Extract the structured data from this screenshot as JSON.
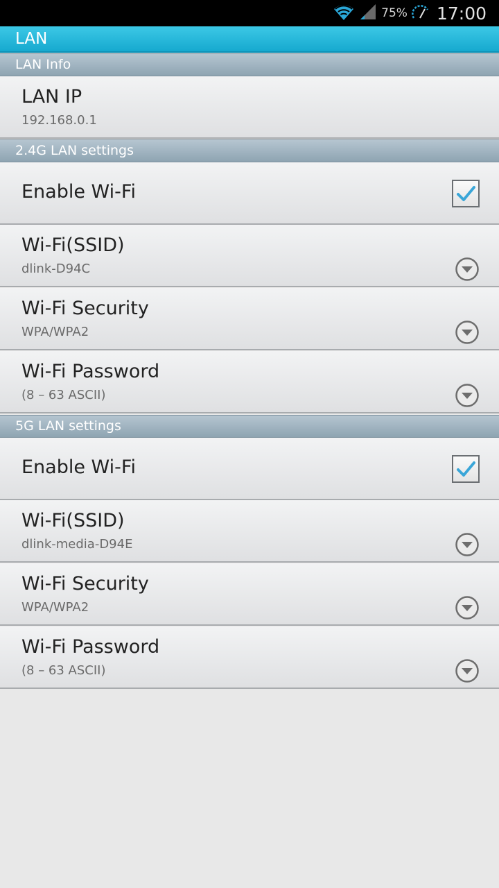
{
  "status_bar": {
    "battery": "75%",
    "time": "17:00",
    "icons": [
      "wifi-signal-icon",
      "cellular-signal-icon",
      "speed-meter-icon"
    ]
  },
  "title_bar": {
    "title": "LAN"
  },
  "sections": {
    "lan_info": {
      "header": "LAN Info",
      "items": [
        {
          "title": "LAN IP",
          "subtitle": "192.168.0.1"
        }
      ]
    },
    "lan_24g": {
      "header": "2.4G LAN settings",
      "enable_wifi": {
        "title": "Enable Wi-Fi",
        "checked": true
      },
      "items": [
        {
          "title": "Wi-Fi(SSID)",
          "subtitle": "dlink-D94C"
        },
        {
          "title": "Wi-Fi Security",
          "subtitle": "WPA/WPA2"
        },
        {
          "title": "Wi-Fi Password",
          "subtitle": "(8 – 63 ASCII)"
        }
      ]
    },
    "lan_5g": {
      "header": "5G LAN settings",
      "enable_wifi": {
        "title": "Enable Wi-Fi",
        "checked": true
      },
      "items": [
        {
          "title": "Wi-Fi(SSID)",
          "subtitle": "dlink-media-D94E"
        },
        {
          "title": "Wi-Fi Security",
          "subtitle": "WPA/WPA2"
        },
        {
          "title": "Wi-Fi Password",
          "subtitle": "(8 – 63 ASCII)"
        }
      ]
    }
  },
  "colors": {
    "accent": "#16a9cf",
    "check": "#3aa6d8",
    "section_header": "#9fb2be"
  }
}
